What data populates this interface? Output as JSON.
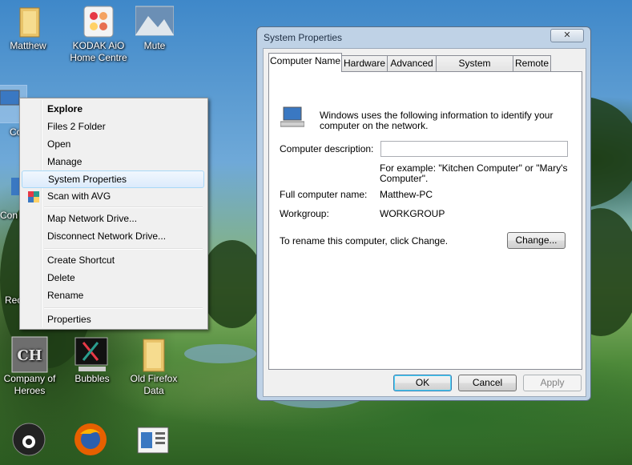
{
  "desktop_icons": [
    {
      "label": "Matthew",
      "icon": "folder-user-icon"
    },
    {
      "label": "KODAK AiO Home Centre",
      "icon": "kodak-icon"
    },
    {
      "label": "Mute",
      "icon": "mountain-icon"
    },
    {
      "label": "Co",
      "icon": "computer-icon"
    },
    {
      "label": "Con",
      "icon": "control-panel-icon"
    },
    {
      "label": "Rec",
      "icon": "recycle-bin-icon"
    },
    {
      "label": "Company of Heroes",
      "icon": "coh-icon"
    },
    {
      "label": "Bubbles",
      "icon": "bubbles-icon"
    },
    {
      "label": "Old Firefox Data",
      "icon": "folder-icon"
    }
  ],
  "context_menu": {
    "items": [
      {
        "label": "Explore"
      },
      {
        "label": "Files 2 Folder"
      },
      {
        "label": "Open"
      },
      {
        "label": "Manage"
      },
      {
        "label": "System Properties"
      },
      {
        "label": "Scan with AVG"
      },
      {
        "label": "Map Network Drive..."
      },
      {
        "label": "Disconnect Network Drive..."
      },
      {
        "label": "Create Shortcut"
      },
      {
        "label": "Delete"
      },
      {
        "label": "Rename"
      },
      {
        "label": "Properties"
      }
    ]
  },
  "dialog": {
    "title": "System Properties",
    "close_glyph": "✕",
    "tabs": [
      "Computer Name",
      "Hardware",
      "Advanced",
      "System Protection",
      "Remote"
    ],
    "intro": "Windows uses the following information to identify your computer on the network.",
    "description_label": "Computer description:",
    "description_value": "",
    "example_text": "For example: \"Kitchen Computer\" or \"Mary's Computer\".",
    "full_name_label": "Full computer name:",
    "full_name_value": "Matthew-PC",
    "workgroup_label": "Workgroup:",
    "workgroup_value": "WORKGROUP",
    "rename_text": "To rename this computer, click Change.",
    "change_button": "Change...",
    "ok_button": "OK",
    "cancel_button": "Cancel",
    "apply_button": "Apply"
  },
  "taskbar_icons": [
    "steam-icon",
    "firefox-icon",
    "document-icon"
  ]
}
